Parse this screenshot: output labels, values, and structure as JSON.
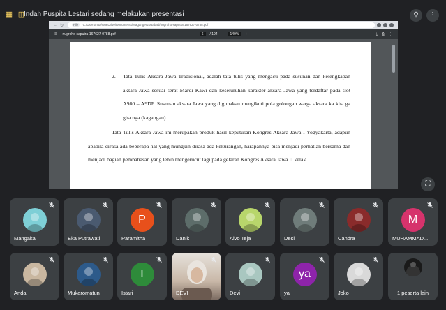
{
  "presenter": {
    "label": "Indah Puspita Lestari sedang melakukan presentasi"
  },
  "browser": {
    "file_tag": "File",
    "url": "C:/Users/nita/OneDrive/Documents/Magang%20Babad/nugroho-saputra-167627-0788.pdf"
  },
  "pdf": {
    "file_name": "nugroho-saputra-167627-0788.pdf",
    "page_current": "6",
    "page_total": "/ 194",
    "zoom": "149%",
    "item_number": "2.",
    "item_text": "Tata Tulis Aksara Jawa Tradisional, adalah tata tulis yang mengacu pada susunan dan kelengkapan aksara Jawa sesuai serat Mardi Kawi dan keseluruhan karakter aksara Jawa yang terdaftar pada slot A980 – A9DF. Susunan aksara Jawa yang digunakan mengikuti pola golongan warga aksara ka kha ga gha nga (kagangan).",
    "paragraph": "Tata Tulis Aksara Jawa ini merupakan produk hasil keputusan Kongres Aksara Jawa I Yogyakarta, adapun apabila dirasa ada beberapa hal yang mungkin dirasa ada kekurangan, harapannya bisa menjadi perhatian bersama dan menjadi bagian pembahasan yang lebih mengerucut lagi pada gelaran Kongres Aksara Jawa II kelak."
  },
  "participants": [
    {
      "name": "Mangaka",
      "kind": "photo",
      "color": "#7ecfd6"
    },
    {
      "name": "Eka Putrawati",
      "kind": "photo",
      "color": "#4a5a70"
    },
    {
      "name": "Paramitha",
      "kind": "letter",
      "letter": "P",
      "color": "#e8501b"
    },
    {
      "name": "Danik",
      "kind": "photo",
      "color": "#5d6d6a"
    },
    {
      "name": "Alvo Teja",
      "kind": "photo",
      "color": "#b8d66b"
    },
    {
      "name": "Desi",
      "kind": "photo",
      "color": "#6f7c7a"
    },
    {
      "name": "Candra",
      "kind": "photo",
      "color": "#8a2b2b"
    },
    {
      "name": "MUHAMMAD...",
      "kind": "letter",
      "letter": "M",
      "color": "#d6336c"
    },
    {
      "name": "Anda",
      "kind": "photo",
      "color": "#c9b7a0"
    },
    {
      "name": "Mukaromatun",
      "kind": "photo",
      "color": "#2d5a8a"
    },
    {
      "name": "Istari",
      "kind": "letter",
      "letter": "I",
      "color": "#2e8b3a"
    },
    {
      "name": "DEVI",
      "kind": "video",
      "color": "#c9b8a8"
    },
    {
      "name": "Devi",
      "kind": "photo",
      "color": "#a9c7c0"
    },
    {
      "name": "ya",
      "kind": "letter",
      "letter": "ya",
      "color": "#8e24aa"
    },
    {
      "name": "Joko",
      "kind": "photo",
      "color": "#d9d9d9"
    }
  ],
  "others": {
    "label": "1 peserta lain"
  },
  "colors": {
    "background": "#202124",
    "tile": "#3c4043"
  }
}
